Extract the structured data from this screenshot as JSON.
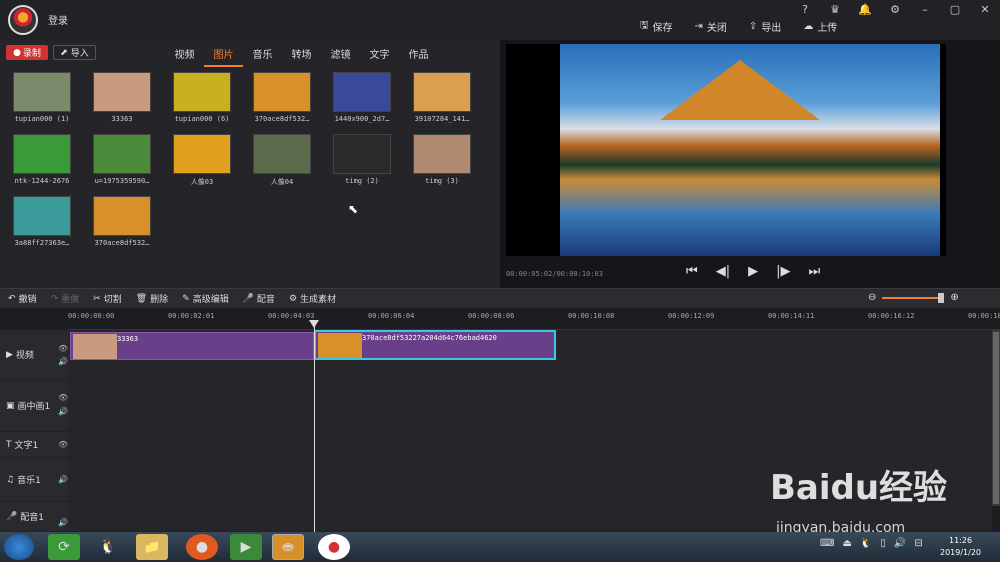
{
  "app": {
    "login_label": "登录"
  },
  "system_icons": [
    "?",
    "VIP",
    "bell",
    "gear",
    "min",
    "max",
    "close"
  ],
  "actions": [
    {
      "label": "保存",
      "icon": "save-icon"
    },
    {
      "label": "关闭",
      "icon": "exit-icon"
    },
    {
      "label": "导出",
      "icon": "export-icon"
    },
    {
      "label": "上传",
      "icon": "upload-icon"
    }
  ],
  "media": {
    "record_label": "录制",
    "import_label": "导入",
    "tabs": [
      "视频",
      "图片",
      "音乐",
      "转场",
      "滤镜",
      "文字",
      "作品"
    ],
    "active_tab": "图片",
    "items": [
      {
        "label": "tupian000 (1)",
        "color": "#7a8a6a"
      },
      {
        "label": "33363",
        "color": "#c89a80"
      },
      {
        "label": "tupian000 (6)",
        "color": "#c8b020"
      },
      {
        "label": "370ace8df532…",
        "color": "#d8902a"
      },
      {
        "label": "1440x900_2d7…",
        "color": "#3a4a9a"
      },
      {
        "label": "39107284_141…",
        "color": "#d8a050"
      },
      {
        "label": "ntk-1244-2676",
        "color": "#3a9a3a"
      },
      {
        "label": "u=1975359590…",
        "color": "#4a8a3a"
      },
      {
        "label": "人像03",
        "color": "#e0a020"
      },
      {
        "label": "人像04",
        "color": "#5a6a4a"
      },
      {
        "label": "timg (2)",
        "color": "#2a2a2a"
      },
      {
        "label": "timg (3)",
        "color": "#b08a70"
      },
      {
        "label": "3a88ff27363e…",
        "color": "#3a9a9a"
      },
      {
        "label": "370ace8df532…",
        "color": "#d8902a"
      }
    ]
  },
  "preview": {
    "time": "00:00:05:02/00:00:10:03"
  },
  "toolbar": {
    "undo": "撤销",
    "redo": "重做",
    "cut": "切割",
    "delete": "删除",
    "advanced": "高级编辑",
    "dub": "配音",
    "generate": "生成素材"
  },
  "zoom": {
    "level": 0.9
  },
  "ruler": [
    "00:00:00:00",
    "00:00:02:01",
    "00:00:04:03",
    "00:00:06:04",
    "00:00:08:06",
    "00:00:10:08",
    "00:00:12:09",
    "00:00:14:11",
    "00:00:16:12",
    "00:00:18:"
  ],
  "tracks": [
    {
      "label": "视频"
    },
    {
      "label": "画中画1"
    },
    {
      "label": "文字1"
    },
    {
      "label": "音乐1"
    },
    {
      "label": "配音1"
    }
  ],
  "clips": {
    "clip1_label": "33363",
    "clip2_label": "370ace8df53227a204d64c76ebad4620"
  },
  "taskbar": {
    "time": "11:26",
    "date": "2019/1/20"
  },
  "watermark": {
    "main": "Baidu经验",
    "url": "jingyan.baidu.com"
  }
}
